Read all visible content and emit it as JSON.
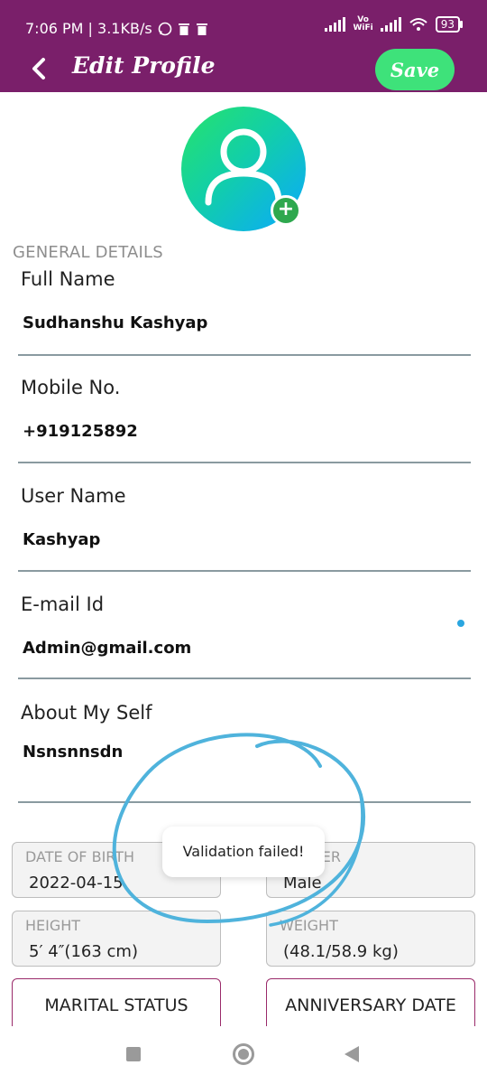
{
  "status_bar": {
    "time_speed": "7:06 PM | 3.1KB/s",
    "vowifi": [
      "Vo",
      "WiFi"
    ],
    "battery": "93"
  },
  "app_bar": {
    "title": "Edit Profile",
    "save_label": "Save"
  },
  "avatar": {
    "add_symbol": "+"
  },
  "section_label": "GENERAL DETAILS",
  "fields": [
    {
      "label": "Full Name",
      "value": "Sudhanshu Kashyap"
    },
    {
      "label": "Mobile No.",
      "value": "+919125892"
    },
    {
      "label": "User Name",
      "value": "Kashyap"
    },
    {
      "label": "E-mail Id",
      "value": "Admin@gmail.com"
    },
    {
      "label": "About My Self",
      "value": "Nsnsnnsdn"
    }
  ],
  "boxes": {
    "dob": {
      "label": "DATE OF BIRTH",
      "value": "2022-04-15"
    },
    "gender": {
      "label": "GENDER",
      "value": "Male"
    },
    "height": {
      "label": "HEIGHT",
      "value": "5′ 4″(163 cm)"
    },
    "weight": {
      "label": "WEIGHT",
      "value": "(48.1/58.9 kg)"
    }
  },
  "buttons": {
    "marital": "MARITAL STATUS",
    "anniversary": "ANNIVERSARY DATE"
  },
  "toast": "Validation failed!",
  "colors": {
    "app_bar": "#7a1f6a",
    "save_button": "#3ee27a",
    "accent_border": "#9a2a6a",
    "scribble": "#4fb3dc"
  },
  "icons": {
    "back": "chevron-left-icon",
    "avatar": "user-icon",
    "add": "plus-icon",
    "nav_recent": "square-icon",
    "nav_home": "circle-icon",
    "nav_back": "triangle-back-icon"
  }
}
